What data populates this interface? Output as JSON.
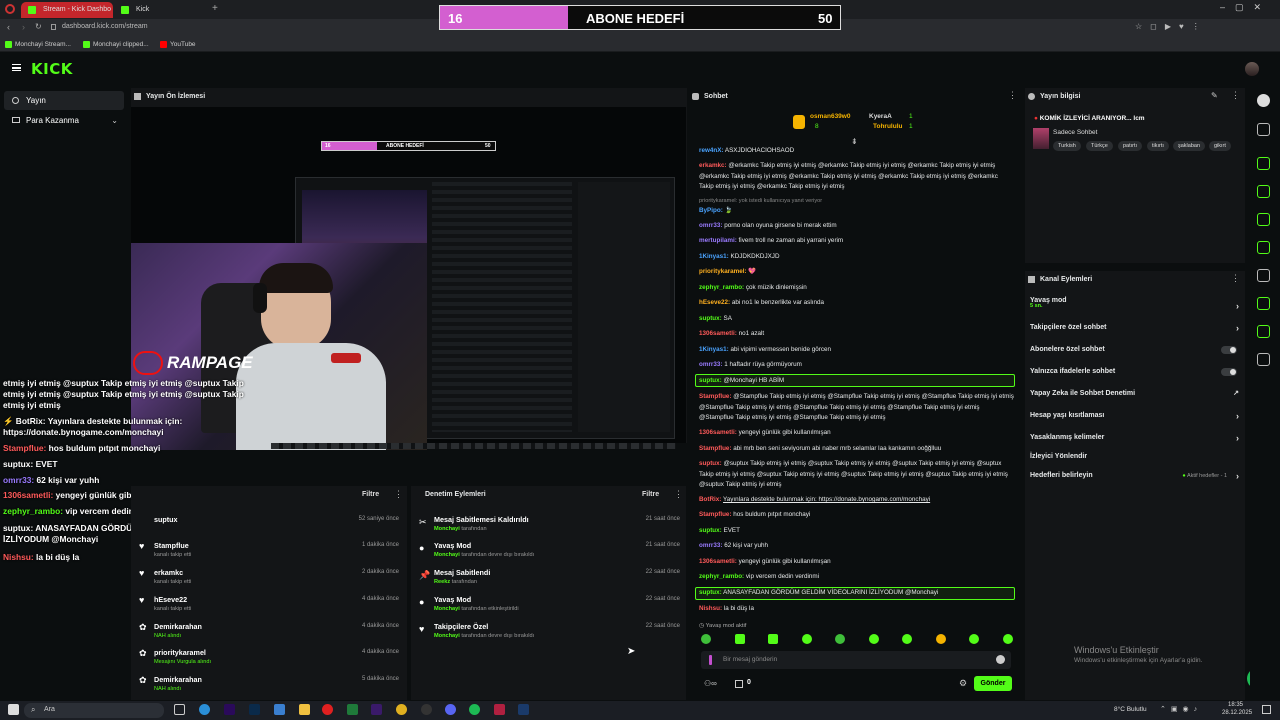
{
  "browser": {
    "tabs": [
      {
        "label": "Stream - Kick Dashbo"
      },
      {
        "label": "Kick"
      }
    ],
    "url": "dashboard.kick.com/stream",
    "bookmarks": [
      {
        "label": "Monchayi Stream..."
      },
      {
        "label": "Monchayi clipped..."
      },
      {
        "label": "YouTube"
      }
    ]
  },
  "goal_bar": {
    "current": "16",
    "title": "ABONE HEDEFİ",
    "target": "50",
    "progress": 0.32
  },
  "kick": {
    "logo": "KICK"
  },
  "leftnav": {
    "items": [
      {
        "label": "Yayın"
      },
      {
        "label": "Para Kazanma"
      }
    ]
  },
  "preview": {
    "title": "Yayın Ön İzlemesi",
    "brand": "RAMPAGE",
    "mini_goal": {
      "current": "16",
      "title": "ABONE HEDEFİ",
      "target": "50"
    },
    "overlay_chat": [
      {
        "text": "etmiş iyi etmiş @suptux Takip etmiş iyi etmiş @suptux Takip"
      },
      {
        "text": "etmiş iyi etmiş @suptux Takip etmiş iyi etmiş @suptux Takip"
      },
      {
        "text": "etmiş iyi etmiş"
      },
      {
        "text": "BotRix: Yayınlara destekte bulunmak için:"
      },
      {
        "text": "https://donate.bynogame.com/monchayi"
      },
      {
        "user": "Stampflue:",
        "text": "hos buldum pıtpıt monchayi"
      },
      {
        "user": "suptux:",
        "text": "EVET"
      },
      {
        "user": "omrr33:",
        "text": "62 kişi var yuhh"
      },
      {
        "user": "1306sametli:",
        "text": "yengeyi günlük gibi kullanılmışan"
      },
      {
        "user": "zephyr_rambo:",
        "text": "vip vercem dedin verdinmi"
      },
      {
        "user": "suptux:",
        "text": "ANASAYFADAN GÖRDÜM GELDİM VİDEOLARINI"
      },
      {
        "text": "İZLİYODUM @Monchayi"
      },
      {
        "user": "Nishsu:",
        "text": "la bi düş la"
      }
    ]
  },
  "activity": {
    "filter_label": "Filtre",
    "items": [
      {
        "name": "suptux",
        "sub": "",
        "time": "52 saniye önce"
      },
      {
        "name": "Stampflue",
        "sub": "kanalı takip etti",
        "time": "1 dakika önce"
      },
      {
        "name": "erkamkc",
        "sub": "kanalı takip etti",
        "time": "2 dakika önce"
      },
      {
        "name": "hEseve22",
        "sub": "kanalı takip etti",
        "time": "4 dakika önce"
      },
      {
        "name": "Demirkarahan",
        "sub": "NAH alındı",
        "time": "4 dakika önce"
      },
      {
        "name": "prioritykaramel",
        "sub": "Mesajını Vurgula alındı",
        "time": "4 dakika önce"
      },
      {
        "name": "Demirkarahan",
        "sub": "NAH alındı",
        "time": "5 dakika önce"
      }
    ]
  },
  "moderation": {
    "title": "Denetim Eylemleri",
    "filter_label": "Filtre",
    "items": [
      {
        "name": "Mesaj Sabitlemesi Kaldırıldı",
        "by": "Monchayi",
        "sub": "tarafından",
        "time": "21 saat önce"
      },
      {
        "name": "Yavaş Mod",
        "by": "Monchayi",
        "sub": "tarafından devre dışı bırakıldı",
        "time": "21 saat önce"
      },
      {
        "name": "Mesaj Sabitlendi",
        "by": "Reekz",
        "sub": "tarafından",
        "time": "22 saat önce"
      },
      {
        "name": "Yavaş Mod",
        "by": "Monchayi",
        "sub": "tarafından etkinleştirildi",
        "time": "22 saat önce"
      },
      {
        "name": "Takipçilere Özel",
        "by": "Monchayi",
        "sub": "tarafından devre dışı bırakıldı",
        "time": "22 saat önce"
      }
    ]
  },
  "chat": {
    "title": "Sohbet",
    "leaderboard": [
      {
        "name": "osman639w0",
        "count": "8"
      },
      {
        "name": "KyeraA",
        "count": "1"
      },
      {
        "name": "Tohrululu",
        "count": "1"
      }
    ],
    "messages": [
      {
        "user": "rew4nX:",
        "text": "ASXJDIOHACIOHSAOD",
        "color": "#4aa3ff"
      },
      {
        "user": "erkamkc:",
        "text": "@erkamkc Takip etmiş iyi etmiş @erkamkc Takip etmiş iyi etmiş @erkamkc Takip etmiş iyi etmiş @erkamkc Takip etmiş iyi etmiş @erkamkc Takip etmiş iyi etmiş @erkamkc Takip etmiş iyi etmiş @erkamkc Takip etmiş iyi etmiş @erkamkc Takip etmiş iyi etmiş",
        "color": "#ff5a5a"
      },
      {
        "user": "",
        "text": "prioritykaramel: yok istedi kullanıcıya yanıt veriyor",
        "color": "#888"
      },
      {
        "user": "ByPipo:",
        "text": "🍃",
        "color": "#4aa3ff"
      },
      {
        "user": "omrr33:",
        "text": "porno olan oyuna girsene bi merak ettim",
        "color": "#9a7bff"
      },
      {
        "user": "mertupilami:",
        "text": "fivem troll ne zaman abi yarrani yerim",
        "color": "#9a7bff"
      },
      {
        "user": "1Kinyas1:",
        "text": "KDJDKDKDJXJD",
        "color": "#4aa3ff"
      },
      {
        "user": "prioritykaramel:",
        "text": "💖",
        "color": "#ffb020"
      },
      {
        "user": "zephyr_rambo:",
        "text": "çok müzik dinlemişsin",
        "color": "#53fc18"
      },
      {
        "user": "hEseve22:",
        "text": "abi no1 le benzerlikte var aslında",
        "color": "#ffb020"
      },
      {
        "user": "suptux:",
        "text": "SA",
        "color": "#53fc18"
      },
      {
        "user": "1306sametli:",
        "text": "no1 azalt",
        "color": "#ff5a5a"
      },
      {
        "user": "1Kinyas1:",
        "text": "abi vipimi vermessen benide görcen",
        "color": "#4aa3ff"
      },
      {
        "user": "omrr33:",
        "text": "1 haftadır rüya görmüyorum",
        "color": "#9a7bff"
      },
      {
        "user": "suptux:",
        "text": "@Monchayi HB ABİM",
        "color": "#53fc18",
        "highlight": true
      },
      {
        "user": "Stampflue:",
        "text": "@Stampflue Takip etmiş iyi etmiş @Stampflue Takip etmiş iyi etmiş @Stampflue Takip etmiş iyi etmiş @Stampflue Takip etmiş iyi etmiş @Stampflue Takip etmiş iyi etmiş @Stampflue Takip etmiş iyi etmiş @Stampflue Takip etmiş iyi etmiş @Stampflue Takip etmiş iyi etmiş",
        "color": "#ff5a5a"
      },
      {
        "user": "1306sametli:",
        "text": "yengeyi günlük gibi kullanılmışan",
        "color": "#ff5a5a"
      },
      {
        "user": "Stampflue:",
        "text": "abi mrb ben seni seviyorum abi naber mrb selamlar laa kankamın ooğğlluu",
        "color": "#ff5a5a"
      },
      {
        "user": "suptux:",
        "text": "@suptux Takip etmiş iyi etmiş @suptux Takip etmiş iyi etmiş @suptux Takip etmiş iyi etmiş @suptux Takip etmiş iyi etmiş @suptux Takip etmiş iyi etmiş @suptux Takip etmiş iyi etmiş @suptux Takip etmiş iyi etmiş @suptux Takip etmiş iyi etmiş",
        "color": "#ff5a5a"
      },
      {
        "user": "BotRix:",
        "text": "Yayınlara destekte bulunmak için: https://donate.bynogame.com/monchayi",
        "color": "#ff5a5a"
      },
      {
        "user": "Stampflue:",
        "text": "hos buldum pıtpıt monchayi",
        "color": "#ff5a5a"
      },
      {
        "user": "suptux:",
        "text": "EVET",
        "color": "#53fc18"
      },
      {
        "user": "omrr33:",
        "text": "62 kişi var yuhh",
        "color": "#9a7bff"
      },
      {
        "user": "1306sametli:",
        "text": "yengeyi günlük gibi kullanılmışan",
        "color": "#ff5a5a"
      },
      {
        "user": "zephyr_rambo:",
        "text": "vip vercem dedin verdinmi",
        "color": "#53fc18"
      },
      {
        "user": "suptux:",
        "text": "ANASAYFADAN GÖRDÜM GELDİM VİDEOLARINI İZLİYODUM @Monchayi",
        "color": "#53fc18",
        "highlight": true
      },
      {
        "user": "Nishsu:",
        "text": "la bi düş la",
        "color": "#ff5a5a"
      }
    ],
    "slow_mode_notice": "Yavaş mod aktif",
    "input_placeholder": "Bir mesaj gönderin",
    "points": "0",
    "send_label": "Gönder"
  },
  "stream_info": {
    "title": "Yayın bilgisi",
    "stream_title": "KOMİK İZLEYİCİ ARANIYOR... lcm",
    "category": "Sadece Sohbet",
    "tags": [
      {
        "label": "Turkish"
      },
      {
        "label": "Türkçe"
      },
      {
        "label": "patırtı"
      },
      {
        "label": "tikırtı"
      },
      {
        "label": "şaklaban"
      },
      {
        "label": "gikırt"
      }
    ]
  },
  "channel_actions": {
    "title": "Kanal Eylemleri",
    "items": [
      {
        "label": "Yavaş mod",
        "sub": "5 sn.",
        "control": "chevron"
      },
      {
        "label": "Takipçilere özel sohbet",
        "control": "chevron"
      },
      {
        "label": "Abonelere özel sohbet",
        "control": "toggle"
      },
      {
        "label": "Yalnızca ifadelerle sohbet",
        "control": "toggle"
      },
      {
        "label": "Yapay Zeka ile Sohbet Denetimi",
        "control": "link"
      },
      {
        "label": "Hesap yaşı kısıtlaması",
        "control": "chevron"
      },
      {
        "label": "Yasaklanmış kelimeler",
        "control": "chevron"
      },
      {
        "label": "İzleyici Yönlendir",
        "control": "none"
      },
      {
        "label": "Hedefleri belirleyin",
        "control": "chevron",
        "status": "Aktif hedefler - 1"
      }
    ]
  },
  "windows_watermark": {
    "line1": "Windows'u Etkinleştir",
    "line2": "Windows'u etkinleştirmek için Ayarlar'a gidin."
  },
  "taskbar": {
    "search": "Ara",
    "weather": "8°C  Bulutlu",
    "time": "18:35",
    "date": "28.12.2025"
  },
  "colors": {
    "accent": "#53fc18",
    "goal_pink": "#d35fd0",
    "bg": "#0b0e0f"
  }
}
